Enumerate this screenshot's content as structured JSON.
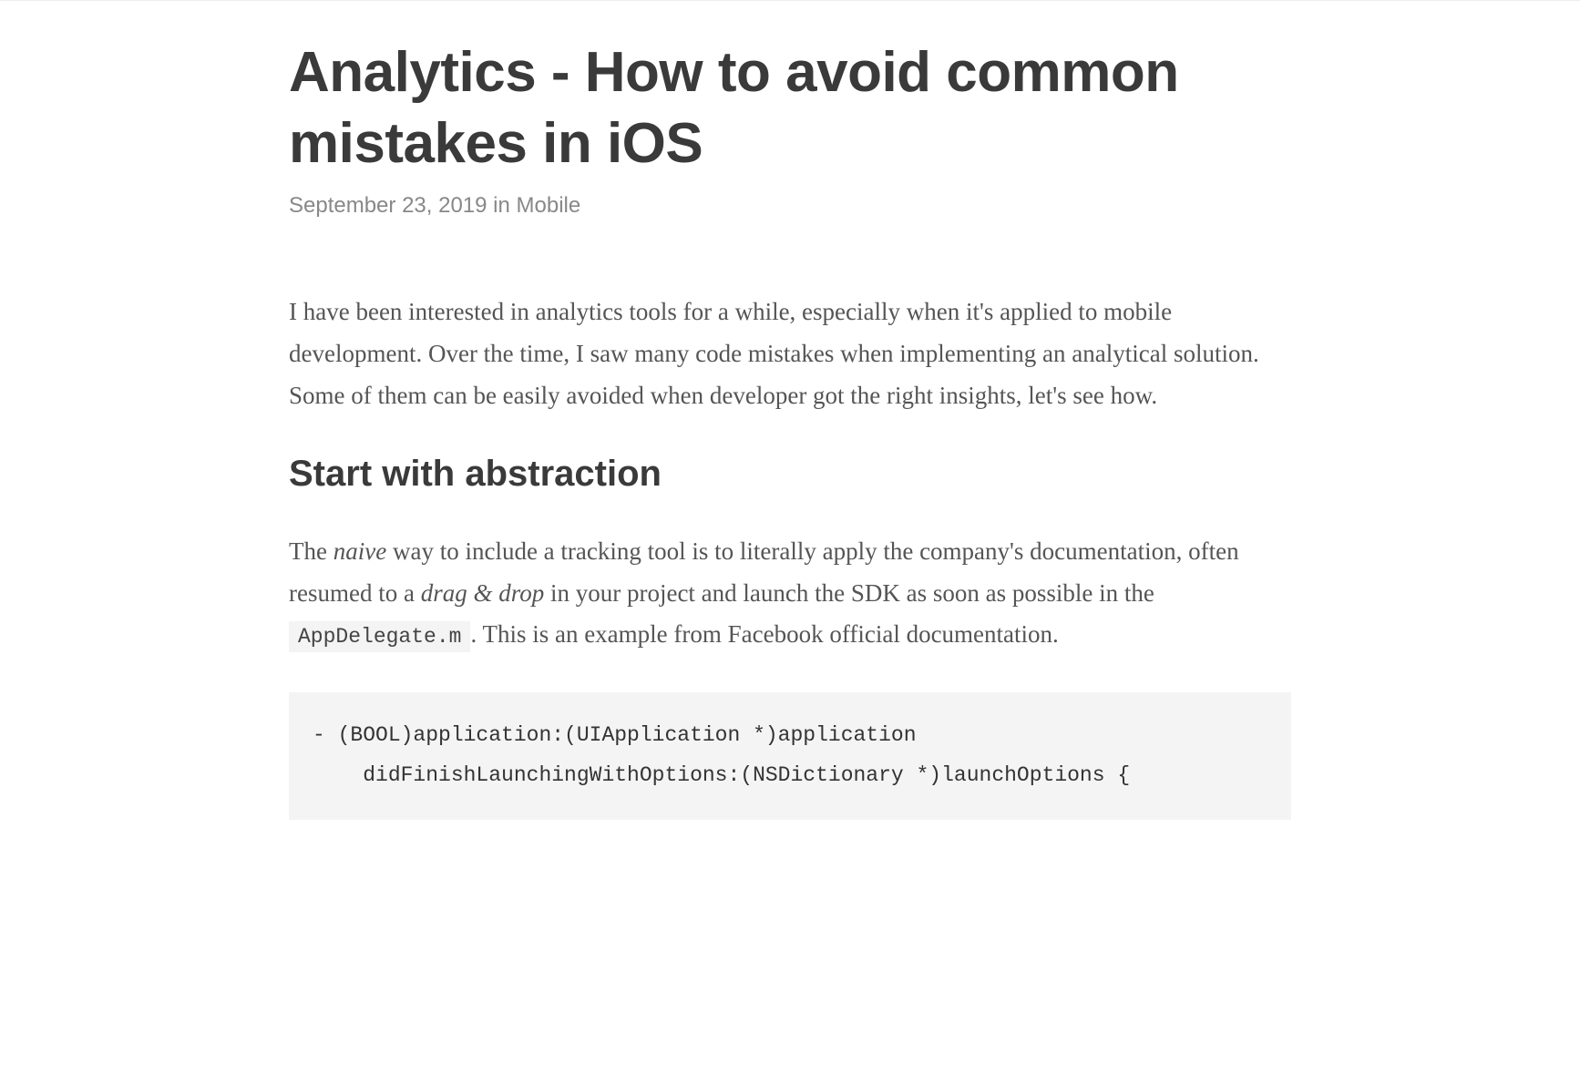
{
  "article": {
    "title": "Analytics - How to avoid common mistakes in iOS",
    "date": "September 23, 2019",
    "meta_in": " in ",
    "category": "Mobile",
    "intro": "I have been interested in analytics tools for a while, especially when it's applied to mobile development. Over the time, I saw many code mistakes when implementing an analytical solution. Some of them can be easily avoided when developer got the right insights, let's see how.",
    "section1_heading": "Start with abstraction",
    "para2_part1": "The ",
    "para2_em1": "naive",
    "para2_part2": " way to include a tracking tool is to literally apply the company's documentation, often resumed to a ",
    "para2_em2": "drag & drop",
    "para2_part3": " in your project and launch the SDK as soon as possible in the ",
    "para2_code": "AppDelegate.m",
    "para2_part4": ". This is an example from Facebook official documentation.",
    "code_block": "- (BOOL)application:(UIApplication *)application\n    didFinishLaunchingWithOptions:(NSDictionary *)launchOptions {\n"
  }
}
